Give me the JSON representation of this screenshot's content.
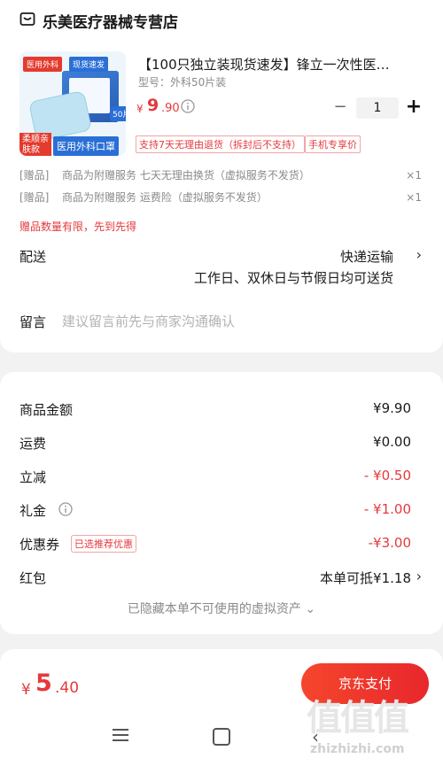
{
  "store": {
    "name": "乐美医疗器械专营店",
    "icon": "store-icon"
  },
  "product": {
    "title": "【100只独立装现货速发】锋立一次性医…",
    "spec": "型号：外科50片装",
    "price": {
      "symbol": "¥",
      "integer": "9",
      "decimal": ".90"
    },
    "quantity": "1",
    "minus": "−",
    "plus": "+",
    "thumbnail": {
      "tag_red": "医用外科",
      "tag_blue": "现货速发",
      "count": "50片",
      "badge_a": "柔顺亲肤款",
      "badge_b": "医用外科口罩"
    },
    "services": [
      "支持7天无理由退货（拆封后不支持）",
      "手机专享价"
    ]
  },
  "gifts": [
    {
      "tag": "[赠品]",
      "text": "商品为附赠服务 七天无理由换货（虚拟服务不发货）",
      "qty": "×1"
    },
    {
      "tag": "[赠品]",
      "text": "商品为附赠服务 运费险（虚拟服务不发货）",
      "qty": "×1"
    }
  ],
  "gift_limit": "赠品数量有限，先到先得",
  "delivery": {
    "label": "配送",
    "method": "快递运输",
    "days": "工作日、双休日与节假日均可送货"
  },
  "message": {
    "label": "留言",
    "placeholder": "建议留言前先与商家沟通确认"
  },
  "summary": {
    "goods_amount": {
      "label": "商品金额",
      "value": "¥9.90"
    },
    "shipping": {
      "label": "运费",
      "value": "¥0.00"
    },
    "instant_discount": {
      "label": "立减",
      "value": "- ¥0.50"
    },
    "gift_money": {
      "label": "礼金",
      "value": "- ¥1.00"
    },
    "coupon": {
      "label": "优惠券",
      "badge": "已选推荐优惠",
      "value": "-¥3.00"
    },
    "red_packet": {
      "label": "红包",
      "value": "本单可抵¥1.18"
    },
    "hidden_assets": "已隐藏本单不可使用的虚拟资产 ⌄"
  },
  "pay": {
    "total": {
      "symbol": "¥",
      "integer": "5",
      "decimal": ".40"
    },
    "button": "京东支付"
  },
  "watermark": {
    "text": "值值值",
    "url": "zhizhizhi.com"
  },
  "colors": {
    "accent": "#e4393c",
    "pay_button": "#f5462d"
  }
}
